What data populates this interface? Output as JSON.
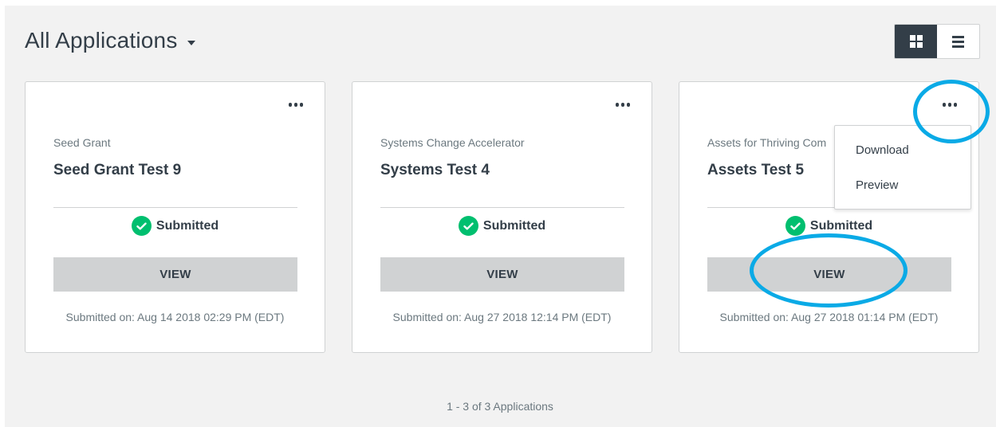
{
  "header": {
    "title": "All Applications",
    "view_toggle": {
      "active": "grid",
      "options": [
        "grid-icon",
        "list-icon"
      ]
    }
  },
  "cards": [
    {
      "program": "Seed Grant",
      "name": "Seed Grant Test 9",
      "status": "Submitted",
      "view_label": "VIEW",
      "submitted_on": "Submitted on: Aug 14 2018 02:29 PM (EDT)"
    },
    {
      "program": "Systems Change Accelerator",
      "name": "Systems Test 4",
      "status": "Submitted",
      "view_label": "VIEW",
      "submitted_on": "Submitted on: Aug 27 2018 12:14 PM (EDT)"
    },
    {
      "program": "Assets for Thriving Com",
      "name": "Assets Test 5",
      "status": "Submitted",
      "view_label": "VIEW",
      "submitted_on": "Submitted on: Aug 27 2018 01:14 PM (EDT)"
    }
  ],
  "dropdown": {
    "items": [
      "Download",
      "Preview"
    ]
  },
  "pagination": "1 - 3 of 3 Applications",
  "colors": {
    "accent_dark": "#333e48",
    "success": "#00bf6f",
    "button_gray": "#d0d2d3",
    "annotation_blue": "#0aaae6"
  }
}
